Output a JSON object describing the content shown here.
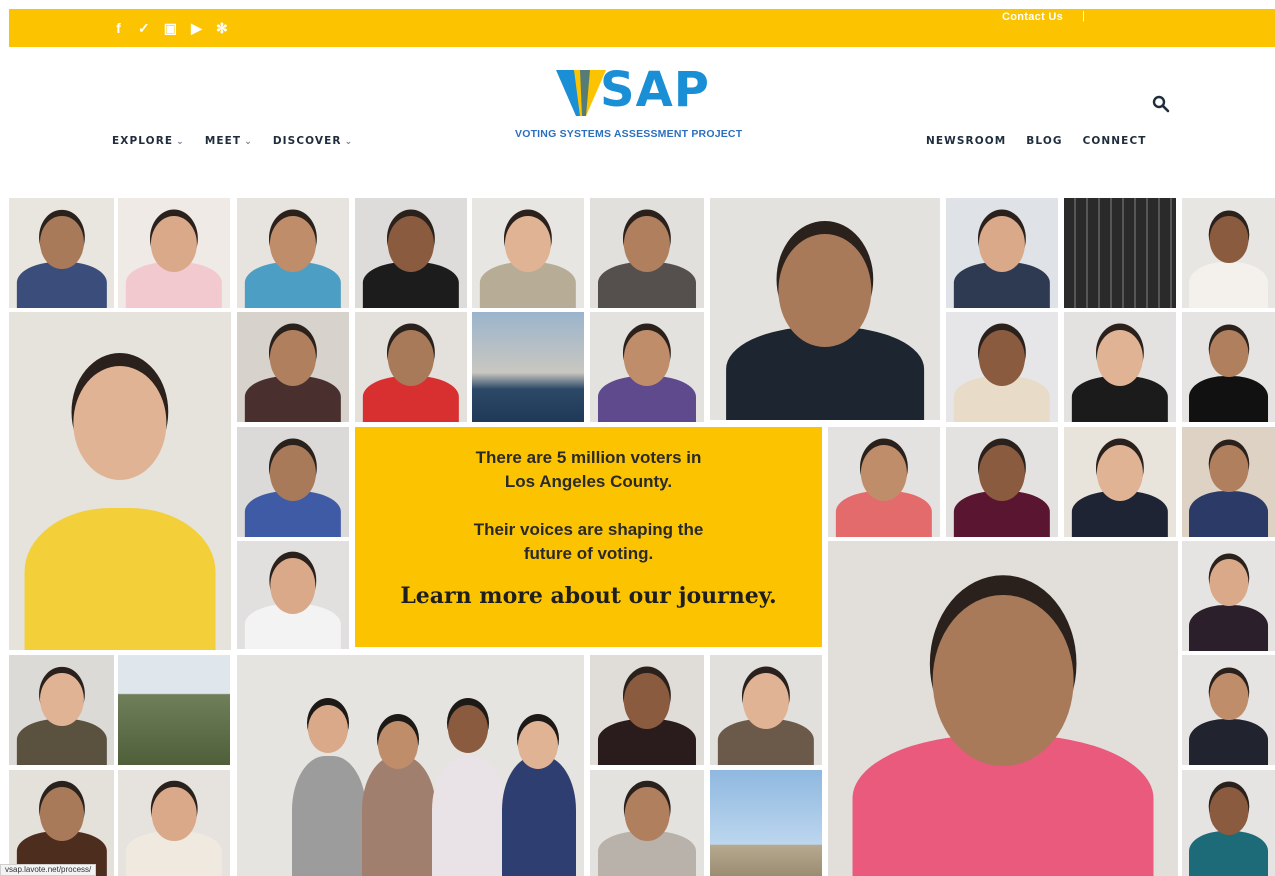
{
  "topbar": {
    "social": [
      {
        "name": "facebook-icon",
        "glyph": "f"
      },
      {
        "name": "twitter-icon",
        "glyph": "✓"
      },
      {
        "name": "instagram-icon",
        "glyph": "▣"
      },
      {
        "name": "youtube-icon",
        "glyph": "▶"
      },
      {
        "name": "yelp-icon",
        "glyph": "✻"
      }
    ],
    "contact_label": "Contact Us",
    "separator": "|"
  },
  "header": {
    "logo_text": "SAP",
    "logo_subtitle": "VOTING SYSTEMS ASSESSMENT PROJECT",
    "nav_left": [
      {
        "label": "EXPLORE",
        "chevron": "⌄"
      },
      {
        "label": "MEET",
        "chevron": "⌄"
      },
      {
        "label": "DISCOVER",
        "chevron": "⌄"
      }
    ],
    "nav_right": [
      {
        "label": "NEWSROOM"
      },
      {
        "label": "BLOG"
      },
      {
        "label": "CONNECT"
      }
    ],
    "search_icon": "search-icon"
  },
  "callout": {
    "line1": "There are 5 million voters in",
    "line2": "Los Angeles County.",
    "line3": "Their voices are shaping the",
    "line4": "future of voting.",
    "cta": "Learn more about our journey."
  },
  "status_bar": {
    "url": "vsap.lavote.net/process/"
  },
  "colors": {
    "brand_yellow": "#fcc400",
    "brand_blue": "#1a8fd6",
    "nav_text": "#1f2d3d"
  }
}
